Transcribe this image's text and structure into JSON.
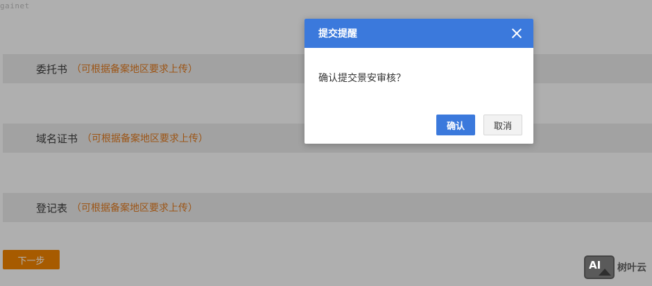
{
  "watermark": "gainet",
  "sections": [
    {
      "name": "委托书",
      "hint": "（可根据备案地区要求上传）"
    },
    {
      "name": "域名证书",
      "hint": "（可根据备案地区要求上传）"
    },
    {
      "name": "登记表",
      "hint": "（可根据备案地区要求上传）"
    }
  ],
  "next_button": "下一步",
  "dialog": {
    "title": "提交提醒",
    "message": "确认提交景安审核？",
    "confirm_label": "确认",
    "cancel_label": "取消"
  },
  "brand": {
    "logo_text": "AI",
    "name": "树叶云"
  },
  "colors": {
    "primary": "#3b79dc",
    "accent_orange": "#f08300",
    "hint_orange": "#e07a20"
  },
  "icons": {
    "close": "close-icon"
  }
}
